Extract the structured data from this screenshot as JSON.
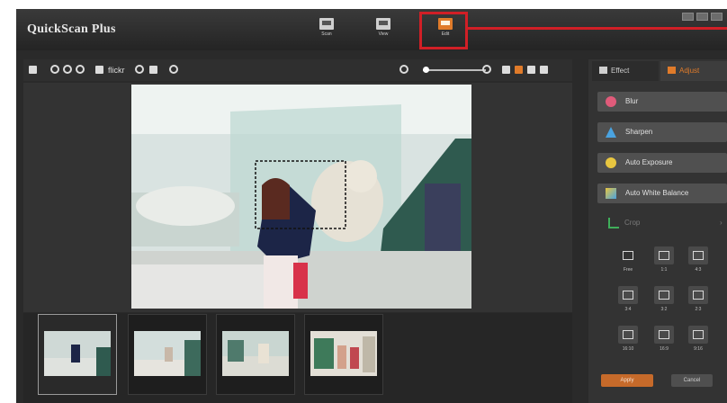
{
  "app": {
    "title": "QuickScan Plus"
  },
  "modes": [
    {
      "label": "Scan"
    },
    {
      "label": "View"
    },
    {
      "label": "Edit"
    }
  ],
  "toolbar": {
    "flickr_label": "flickr"
  },
  "panel": {
    "tabs": [
      {
        "label": "Effect"
      },
      {
        "label": "Adjust"
      }
    ],
    "actions": [
      {
        "label": "Blur",
        "icon": "blur-icon"
      },
      {
        "label": "Sharpen",
        "icon": "sharpen-icon"
      },
      {
        "label": "Auto Exposure",
        "icon": "auto-exposure-icon"
      },
      {
        "label": "Auto White Balance",
        "icon": "auto-white-balance-icon"
      }
    ],
    "crop": {
      "label": "Crop"
    },
    "ratios": [
      {
        "label": "Free"
      },
      {
        "label": "1:1"
      },
      {
        "label": "4:3"
      },
      {
        "label": "3:4"
      },
      {
        "label": "3:2"
      },
      {
        "label": "2:3"
      },
      {
        "label": "16:10"
      },
      {
        "label": "16:9"
      },
      {
        "label": "9:16"
      }
    ],
    "apply_label": "Apply",
    "cancel_label": "Cancel"
  },
  "colors": {
    "accent": "#e07b2a",
    "highlight": "#d11f26",
    "background": "#2a2a2a"
  }
}
